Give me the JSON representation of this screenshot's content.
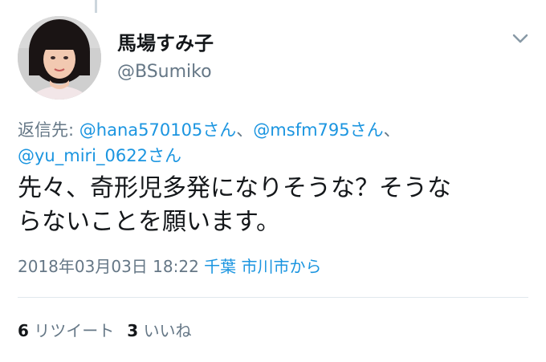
{
  "tweet": {
    "display_name": "馬場すみ子",
    "handle": "@BSumiko",
    "reply_to_label": "返信先:",
    "mentions": [
      "@hana570105さん",
      "@msfm795さん",
      "@yu_miri_0622さん"
    ],
    "separator": "、",
    "text": "先々、奇形児多発になりそうな？そうな\nらないことを願います。",
    "timestamp": "2018年03月03日 18:22",
    "place": "千葉 市川市から",
    "retweets_count": "6",
    "retweets_label": "リツイート",
    "likes_count": "3",
    "likes_label": "いいね"
  },
  "icons": {
    "menu": "chevron-down-icon"
  },
  "colors": {
    "link": "#1b95e0",
    "secondary_text": "#657786",
    "primary_text": "#14171a",
    "divider": "#e1e8ed"
  }
}
